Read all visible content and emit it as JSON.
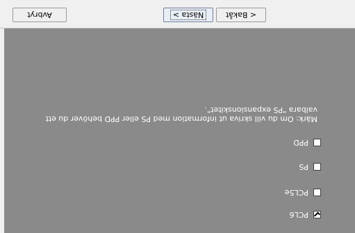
{
  "options": [
    {
      "label": "PCL6",
      "checked": true
    },
    {
      "label": "PCL5e",
      "checked": false
    },
    {
      "label": "PS",
      "checked": false
    },
    {
      "label": "PPD",
      "checked": false
    }
  ],
  "note": "Märk: Om du vill skriva ut information med PS eller PPD behöver du ett valbara \"PS expansionskitet\".",
  "buttons": {
    "back": "< Bakåt",
    "next": "Nästa >",
    "cancel": "Avbryt"
  },
  "colors": {
    "panel": "#8a8a8a",
    "bar": "#f0f0f0"
  },
  "icons": {
    "cursor": "mouse-pointer-icon",
    "checkbox": "checkbox-icon"
  }
}
